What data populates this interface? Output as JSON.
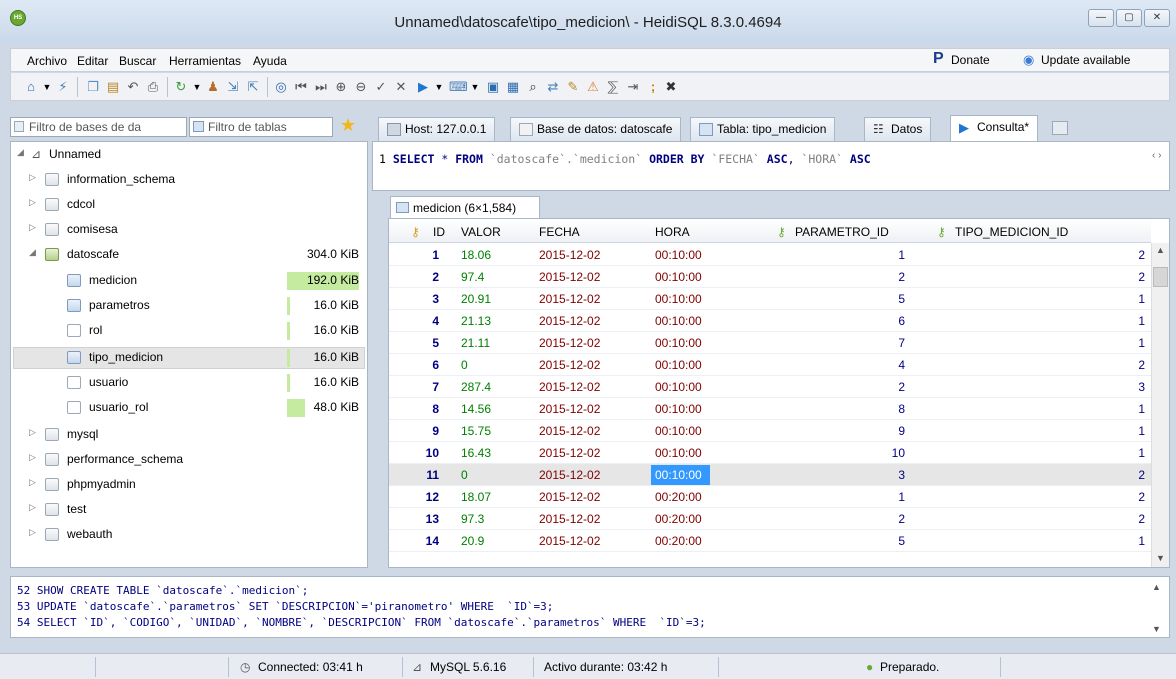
{
  "window": {
    "title": "Unnamed\\datoscafe\\tipo_medicion\\ - HeidiSQL 8.3.0.4694",
    "app_logo": "HS"
  },
  "menu": {
    "items": [
      "Archivo",
      "Editar",
      "Buscar",
      "Herramientas",
      "Ayuda"
    ],
    "donate": "Donate",
    "update": "Update available"
  },
  "left": {
    "filter_db": "Filtro de bases de da",
    "filter_tables": "Filtro de tablas",
    "tree": {
      "root": "Unnamed",
      "databases": [
        "information_schema",
        "cdcol",
        "comisesa"
      ],
      "open_db": {
        "name": "datoscafe",
        "size": "304.0 KiB"
      },
      "tables": [
        {
          "name": "medicion",
          "size": "192.0 KiB",
          "fill": 1.0
        },
        {
          "name": "parametros",
          "size": "16.0 KiB",
          "fill": 0.03
        },
        {
          "name": "rol",
          "size": "16.0 KiB",
          "fill": 0.03
        },
        {
          "name": "tipo_medicion",
          "size": "16.0 KiB",
          "fill": 0.03
        },
        {
          "name": "usuario",
          "size": "16.0 KiB",
          "fill": 0.03
        },
        {
          "name": "usuario_rol",
          "size": "48.0 KiB",
          "fill": 0.25
        }
      ],
      "databases_after": [
        "mysql",
        "performance_schema",
        "phpmyadmin",
        "test",
        "webauth"
      ]
    }
  },
  "tabs": [
    {
      "label": "Host: 127.0.0.1"
    },
    {
      "label": "Base de datos: datoscafe"
    },
    {
      "label": "Tabla: tipo_medicion"
    },
    {
      "label": "Datos"
    },
    {
      "label": "Consulta*"
    }
  ],
  "editor": {
    "line_no": "1",
    "kw_select": "SELECT",
    "star": " * ",
    "kw_from": "FROM",
    "tbl": " `datoscafe`.`medicion` ",
    "kw_order": "ORDER BY",
    "c1": " `FECHA` ",
    "kw_asc1": "ASC",
    "comma": ", ",
    "c2": "`HORA` ",
    "kw_asc2": "ASC"
  },
  "result_tab": "medicion (6×1,584)",
  "grid": {
    "columns": [
      "ID",
      "VALOR",
      "FECHA",
      "HORA",
      "PARAMETRO_ID",
      "TIPO_MEDICION_ID"
    ],
    "rows": [
      [
        "1",
        "18.06",
        "2015-12-02",
        "00:10:00",
        "1",
        "2"
      ],
      [
        "2",
        "97.4",
        "2015-12-02",
        "00:10:00",
        "2",
        "2"
      ],
      [
        "3",
        "20.91",
        "2015-12-02",
        "00:10:00",
        "5",
        "1"
      ],
      [
        "4",
        "21.13",
        "2015-12-02",
        "00:10:00",
        "6",
        "1"
      ],
      [
        "5",
        "21.11",
        "2015-12-02",
        "00:10:00",
        "7",
        "1"
      ],
      [
        "6",
        "0",
        "2015-12-02",
        "00:10:00",
        "4",
        "2"
      ],
      [
        "7",
        "287.4",
        "2015-12-02",
        "00:10:00",
        "2",
        "3"
      ],
      [
        "8",
        "14.56",
        "2015-12-02",
        "00:10:00",
        "8",
        "1"
      ],
      [
        "9",
        "15.75",
        "2015-12-02",
        "00:10:00",
        "9",
        "1"
      ],
      [
        "10",
        "16.43",
        "2015-12-02",
        "00:10:00",
        "10",
        "1"
      ],
      [
        "11",
        "0",
        "2015-12-02",
        "00:10:00",
        "3",
        "2"
      ],
      [
        "12",
        "18.07",
        "2015-12-02",
        "00:20:00",
        "1",
        "2"
      ],
      [
        "13",
        "97.3",
        "2015-12-02",
        "00:20:00",
        "2",
        "2"
      ],
      [
        "14",
        "20.9",
        "2015-12-02",
        "00:20:00",
        "5",
        "1"
      ]
    ],
    "selected_row": 10
  },
  "log": {
    "lines": [
      "52 SHOW CREATE TABLE `datoscafe`.`medicion`;",
      "53 UPDATE `datoscafe`.`parametros` SET `DESCRIPCION`='piranometro' WHERE  `ID`=3;",
      "54 SELECT `ID`, `CODIGO`, `UNIDAD`, `NOMBRE`, `DESCRIPCION` FROM `datoscafe`.`parametros` WHERE  `ID`=3;"
    ]
  },
  "status": {
    "connected": "Connected: 03:41 h",
    "server": "MySQL 5.6.16",
    "uptime": "Activo durante: 03:42 h",
    "state": "Preparado."
  },
  "colors": {
    "accent_selection": "#3399ff",
    "size_bar": "#c4eba0",
    "keyword": "#000080",
    "value": "#008000",
    "date": "#800000"
  }
}
